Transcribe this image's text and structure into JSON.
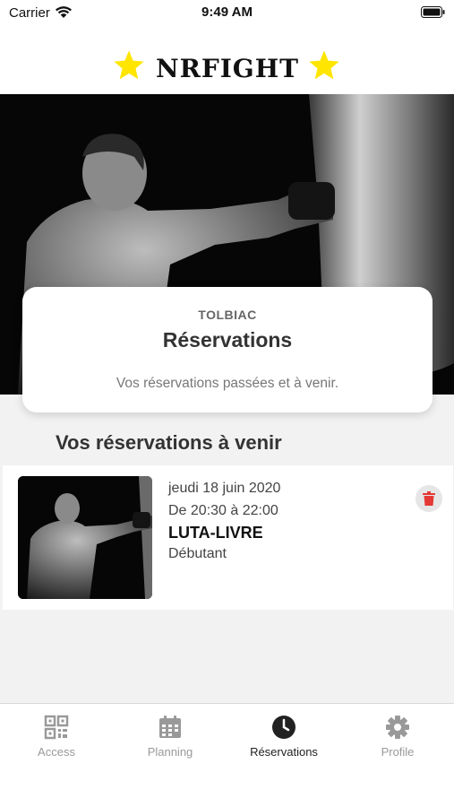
{
  "status_bar": {
    "carrier": "Carrier",
    "time": "9:49 AM"
  },
  "brand": {
    "logo_text": "NRFIGHT",
    "star_color": "#FFE500"
  },
  "header_card": {
    "location": "TOLBIAC",
    "title": "Réservations",
    "subtitle": "Vos réservations passées et à venir."
  },
  "upcoming": {
    "section_title": "Vos réservations à venir",
    "bookings": [
      {
        "date": "jeudi 18 juin 2020",
        "time_range": "De 20:30 à 22:00",
        "class_name": "LUTA-LIVRE",
        "level": "Débutant",
        "delete_icon": "trash-icon",
        "delete_color": "#E53935"
      }
    ]
  },
  "tab_bar": {
    "active_tab": "reservations",
    "tabs": [
      {
        "id": "access",
        "label": "Access",
        "icon": "qr-code-icon"
      },
      {
        "id": "planning",
        "label": "Planning",
        "icon": "calendar-icon"
      },
      {
        "id": "reservations",
        "label": "Réservations",
        "icon": "clock-icon"
      },
      {
        "id": "profile",
        "label": "Profile",
        "icon": "gear-icon"
      }
    ]
  }
}
